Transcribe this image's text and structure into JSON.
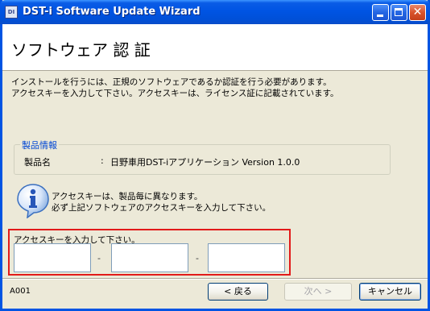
{
  "window": {
    "title": "DST-i Software Update Wizard",
    "icon_text": "DI"
  },
  "header": {
    "title": "ソフトウェア 認 証"
  },
  "intro": {
    "line1": "インストールを行うには、正規のソフトウェアであるか認証を行う必要があります。",
    "line2": "アクセスキーを入力して下さい。アクセスキーは、ライセンス証に記載されています。"
  },
  "product_info": {
    "group_label": "製品情報",
    "name_label": "製品名",
    "colon": ":",
    "name_value": "日野車用DST-iアプリケーション Version 1.0.0"
  },
  "notice": {
    "icon": "info-icon",
    "line1": "アクセスキーは、製品毎に異なります。",
    "line2": "必ず上記ソフトウェアのアクセスキーを入力して下さい。"
  },
  "access_key": {
    "label": "アクセスキーを入力して下さい。",
    "separator": "-",
    "fields": [
      "",
      "",
      ""
    ]
  },
  "footer": {
    "screen_id": "A001",
    "back_label": "< 戻る",
    "next_label": "次へ >",
    "cancel_label": "キャンセル"
  },
  "colors": {
    "titlebar": "#0054e3",
    "highlight_frame": "#e21a1a",
    "group_label": "#0046d5"
  }
}
